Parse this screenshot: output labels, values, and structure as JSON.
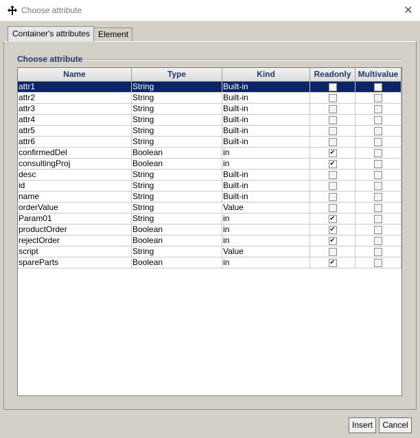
{
  "window": {
    "title": "Choose attribute",
    "close_glyph": "✕",
    "icon": "move-cross-icon"
  },
  "tabs": [
    {
      "label": "Container's attributes",
      "active": true
    },
    {
      "label": "Element",
      "active": false
    }
  ],
  "group": {
    "label": "Choose attribute"
  },
  "table": {
    "columns": [
      "Name",
      "Type",
      "Kind",
      "Readonly",
      "Multivalue"
    ],
    "selected_row": 0,
    "rows": [
      {
        "name": "attr1",
        "type": "String",
        "kind": "Built-in",
        "readonly": false,
        "multivalue": false
      },
      {
        "name": "attr2",
        "type": "String",
        "kind": "Built-in",
        "readonly": false,
        "multivalue": false
      },
      {
        "name": "attr3",
        "type": "String",
        "kind": "Built-in",
        "readonly": false,
        "multivalue": false
      },
      {
        "name": "attr4",
        "type": "String",
        "kind": "Built-in",
        "readonly": false,
        "multivalue": false
      },
      {
        "name": "attr5",
        "type": "String",
        "kind": "Built-in",
        "readonly": false,
        "multivalue": false
      },
      {
        "name": "attr6",
        "type": "String",
        "kind": "Built-in",
        "readonly": false,
        "multivalue": false
      },
      {
        "name": "confirmedDel",
        "type": "Boolean",
        "kind": "in",
        "readonly": true,
        "multivalue": false
      },
      {
        "name": "consultingProj",
        "type": "Boolean",
        "kind": "in",
        "readonly": true,
        "multivalue": false
      },
      {
        "name": "desc",
        "type": "String",
        "kind": "Built-in",
        "readonly": false,
        "multivalue": false
      },
      {
        "name": "id",
        "type": "String",
        "kind": "Built-in",
        "readonly": false,
        "multivalue": false
      },
      {
        "name": "name",
        "type": "String",
        "kind": "Built-in",
        "readonly": false,
        "multivalue": false
      },
      {
        "name": "orderValue",
        "type": "String",
        "kind": "Value",
        "readonly": false,
        "multivalue": false
      },
      {
        "name": "Param01",
        "type": "String",
        "kind": "in",
        "readonly": true,
        "multivalue": false
      },
      {
        "name": "productOrder",
        "type": "Boolean",
        "kind": "in",
        "readonly": true,
        "multivalue": false
      },
      {
        "name": "rejectOrder",
        "type": "Boolean",
        "kind": "in",
        "readonly": true,
        "multivalue": false
      },
      {
        "name": "script",
        "type": "String",
        "kind": "Value",
        "readonly": false,
        "multivalue": false
      },
      {
        "name": "spareParts",
        "type": "Boolean",
        "kind": "in",
        "readonly": true,
        "multivalue": false
      }
    ]
  },
  "buttons": {
    "insert": "Insert",
    "cancel": "Cancel"
  },
  "colors": {
    "selection": "#0a246a",
    "header_text": "#1f3a6e",
    "dialog_bg": "#d4d0c8"
  }
}
